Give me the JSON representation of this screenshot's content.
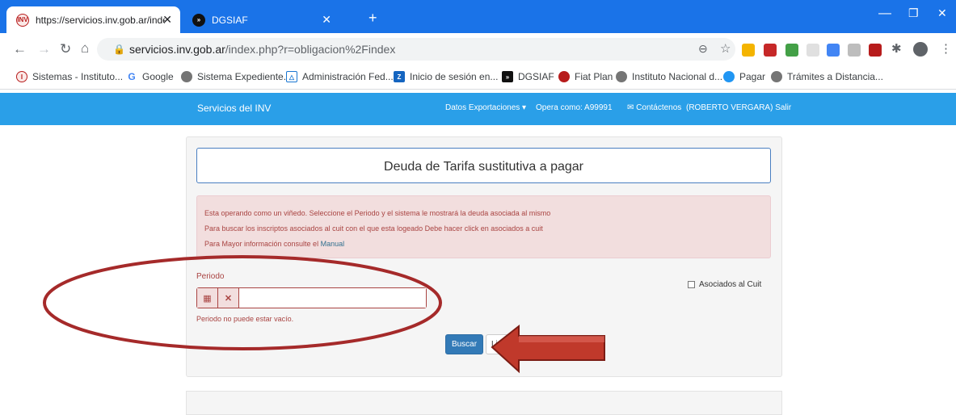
{
  "browser": {
    "tabs": [
      {
        "label": "https://servicios.inv.gob.ar/index",
        "close": "✕"
      },
      {
        "label": "DGSIAF",
        "close": "✕"
      }
    ],
    "new_tab": "+",
    "url_host": "servicios.inv.gob.ar",
    "url_path": "/index.php?r=obligacion%2Findex",
    "bookmarks": [
      "Sistemas - Instituto...",
      "Google",
      "Sistema Expediente...",
      "Administración Fed...",
      "Inicio de sesión en...",
      "DGSIAF",
      "Fiat Plan",
      "Instituto Nacional d...",
      "Pagar",
      "Trámites a Distancia..."
    ]
  },
  "site_nav": {
    "brand": "Servicios del INV",
    "exportaciones": "Datos Exportaciones ▾",
    "opera_como": "Opera como: A99991",
    "contactenos": "✉ Contáctenos",
    "user": "(ROBERTO VERGARA) Salir"
  },
  "page": {
    "title": "Deuda de Tarifa sustitutiva a pagar",
    "alert_line1": "Esta operando como un viñedo. Seleccione el Periodo y el sistema le mostrará la deuda asociada al mismo",
    "alert_line2": "Para buscar los inscriptos asociados al cuit con el que esta logeado Debe hacer click en asociados a cuit",
    "alert_line3_prefix": "Para Mayor información consulte el ",
    "alert_link": "Manual",
    "periodo_label": "Periodo",
    "periodo_value": "",
    "periodo_error": "Periodo no puede estar vacío.",
    "asociados_label": "Asociados al Cuit",
    "buscar_label": "Buscar",
    "second_button_label": "Lim"
  },
  "colors": {
    "chrome_blue": "#1a73e8",
    "nav_blue": "#2a9fe8",
    "error_red": "#a94442",
    "annotation_red": "#b03a2e"
  }
}
